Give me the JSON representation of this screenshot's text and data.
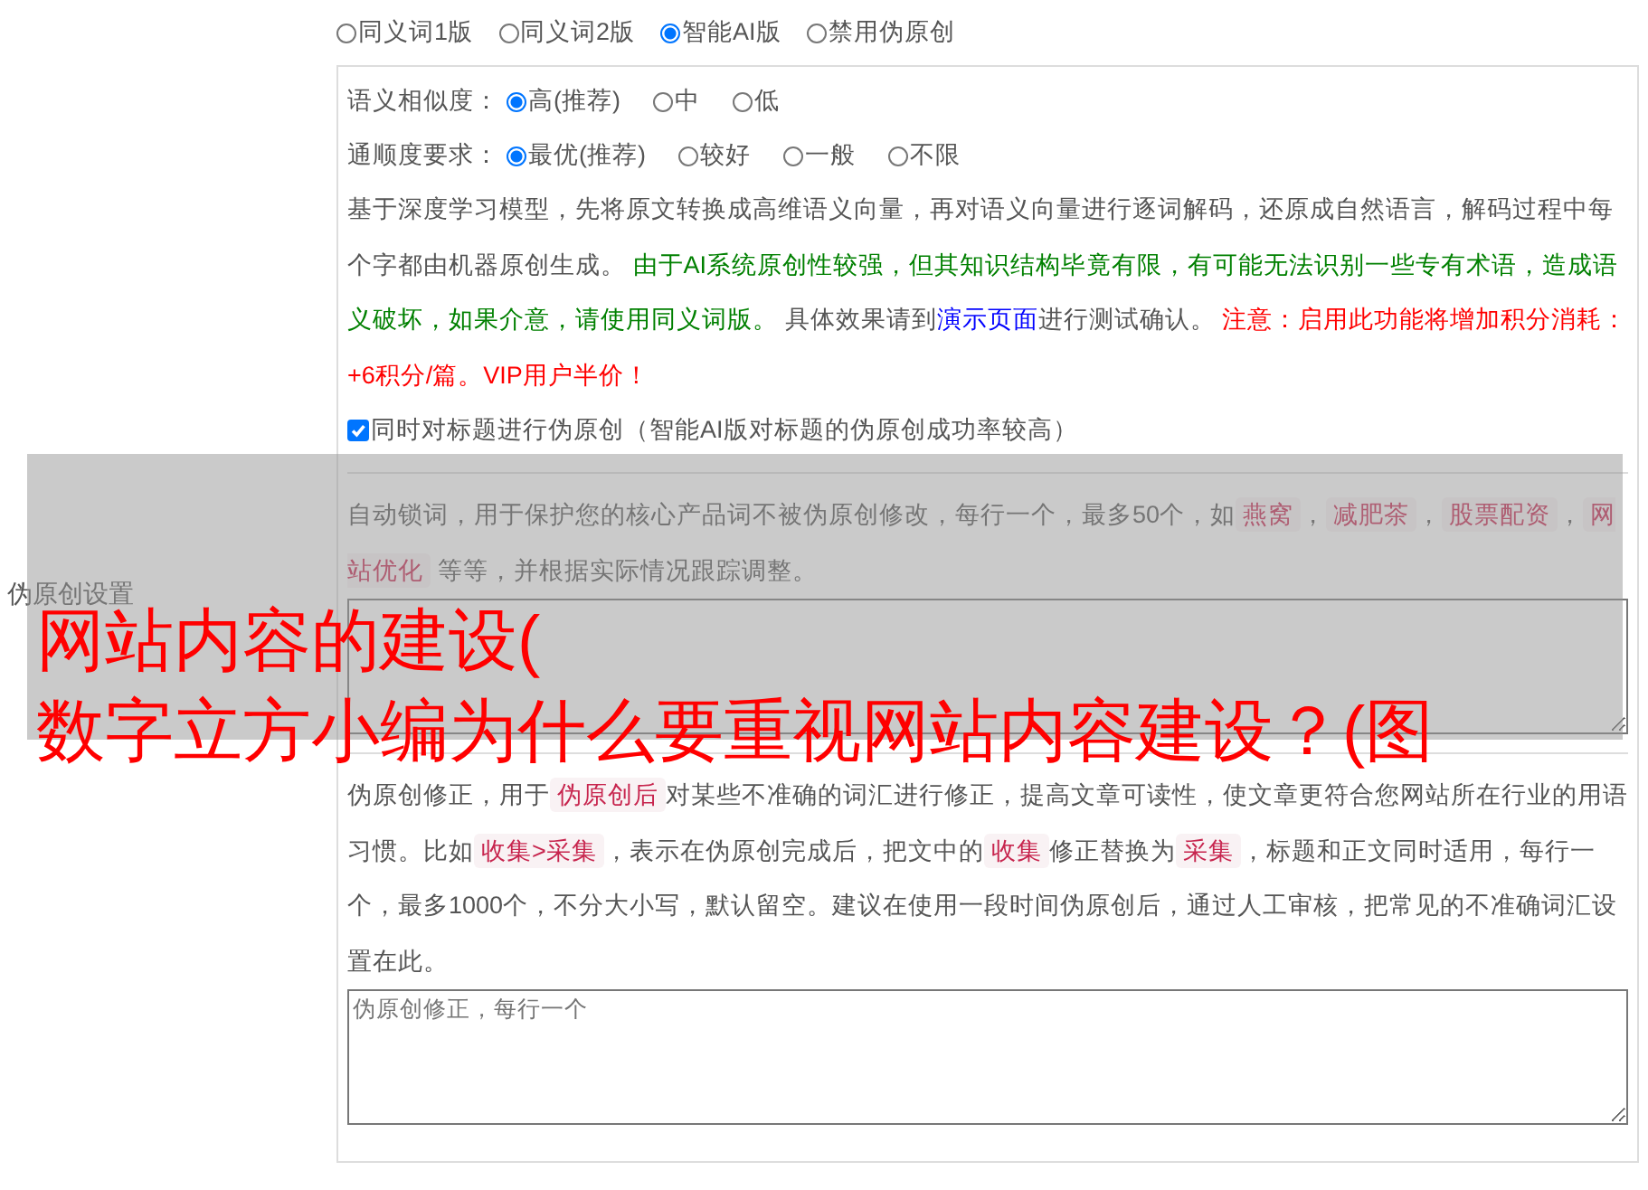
{
  "settings_label": "伪原创设置",
  "modes": [
    {
      "label": "同义词1版",
      "selected": false
    },
    {
      "label": "同义词2版",
      "selected": false
    },
    {
      "label": "智能AI版",
      "selected": true
    },
    {
      "label": "禁用伪原创",
      "selected": false
    }
  ],
  "similarity": {
    "label": "语义相似度：",
    "options": [
      {
        "label": "高(推荐)",
        "selected": true
      },
      {
        "label": "中",
        "selected": false
      },
      {
        "label": "低",
        "selected": false
      }
    ]
  },
  "fluency": {
    "label": "通顺度要求：",
    "options": [
      {
        "label": "最优(推荐)",
        "selected": true
      },
      {
        "label": "较好",
        "selected": false
      },
      {
        "label": "一般",
        "selected": false
      },
      {
        "label": "不限",
        "selected": false
      }
    ]
  },
  "ai_description": [
    {
      "kind": "plain",
      "text": "基于深度学习模型，先将原文转换成高维语义向量，再对语义向量进行逐词解码，还原成自然语言，解码过程中每个字都由机器原创生成。 "
    },
    {
      "kind": "green",
      "text": "由于AI系统原创性较强，但其知识结构毕竟有限，有可能无法识别一些专有术语，造成语义破坏，如果介意，请使用同义词版。"
    },
    {
      "kind": "plain",
      "text": " 具体效果请到"
    },
    {
      "kind": "link",
      "text": "演示页面"
    },
    {
      "kind": "plain",
      "text": "进行测试确认。 "
    },
    {
      "kind": "red",
      "text": "注意：启用此功能将增加积分消耗：+6积分/篇。VIP用户半价！"
    }
  ],
  "title_option": {
    "label": "同时对标题进行伪原创（智能AI版对标题的伪原创成功率较高）",
    "checked": true
  },
  "lock_words": {
    "description": [
      {
        "kind": "plain",
        "text": "自动锁词，用于保护您的核心产品词不被伪原创修改，每行一个，最多50个，如"
      },
      {
        "kind": "code",
        "text": "燕窝"
      },
      {
        "kind": "plain",
        "text": "，"
      },
      {
        "kind": "code",
        "text": "减肥茶"
      },
      {
        "kind": "plain",
        "text": "，"
      },
      {
        "kind": "code",
        "text": "股票配资"
      },
      {
        "kind": "plain",
        "text": "，"
      },
      {
        "kind": "code",
        "text": "网站优化"
      },
      {
        "kind": "plain",
        "text": " 等等，并根据实际情况跟踪调整。"
      }
    ]
  },
  "corrections": {
    "description": [
      {
        "kind": "plain",
        "text": "伪原创修正，用于"
      },
      {
        "kind": "code",
        "text": "伪原创后"
      },
      {
        "kind": "plain",
        "text": "对某些不准确的词汇进行修正，提高文章可读性，使文章更符合您网站所在行业的用语习惯。比如"
      },
      {
        "kind": "code",
        "text": "收集>采集"
      },
      {
        "kind": "plain",
        "text": "，表示在伪原创完成后，把文中的"
      },
      {
        "kind": "code",
        "text": "收集"
      },
      {
        "kind": "plain",
        "text": "修正替换为"
      },
      {
        "kind": "code",
        "text": "采集"
      },
      {
        "kind": "plain",
        "text": "，标题和正文同时适用，每行一个，最多1000个，不分大小写，默认留空。建议在使用一段时间伪原创后，通过人工审核，把常见的不准确词汇设置在此。"
      }
    ],
    "placeholder": "伪原创修正，每行一个"
  },
  "overlay_title": [
    "网站内容的建设(",
    "数字立方小编为什么要重视网站内容建设？(图"
  ]
}
